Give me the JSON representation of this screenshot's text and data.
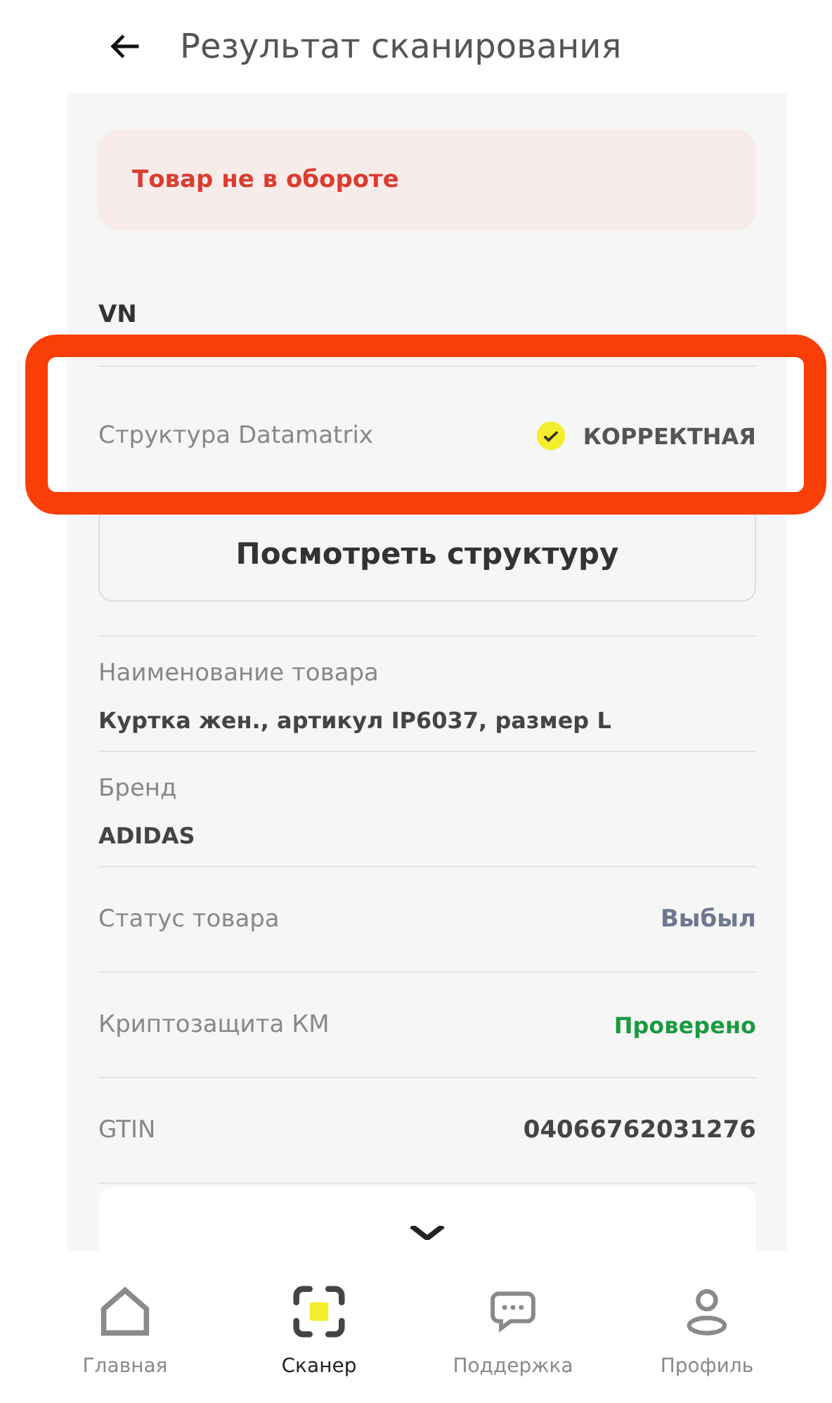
{
  "header": {
    "title": "Результат сканирования"
  },
  "alert": {
    "text": "Товар не в обороте"
  },
  "country": "VN",
  "structure": {
    "label": "Структура Datamatrix",
    "status": "КОРРЕКТНАЯ",
    "valid": true,
    "highlighted": true
  },
  "view_button": "Посмотреть структуру",
  "details": [
    {
      "label": "Наименование товара",
      "value": "Куртка жен., артикул IP6037, размер L",
      "kind": "stacked"
    },
    {
      "label": "Бренд",
      "value": "ADIDAS",
      "kind": "stacked"
    },
    {
      "label": "Статус товара",
      "value": "Выбыл",
      "kind": "muted"
    },
    {
      "label": "Криптозащита КМ",
      "value": "Проверено",
      "kind": "success"
    },
    {
      "label": "GTIN",
      "value": "04066762031276",
      "kind": "plain"
    }
  ],
  "nav": [
    {
      "label": "Главная",
      "kind": "home",
      "selected": false
    },
    {
      "label": "Сканер",
      "kind": "scanner",
      "selected": true
    },
    {
      "label": "Поддержка",
      "kind": "chat",
      "selected": false
    },
    {
      "label": "Профиль",
      "kind": "profile",
      "selected": false
    }
  ]
}
